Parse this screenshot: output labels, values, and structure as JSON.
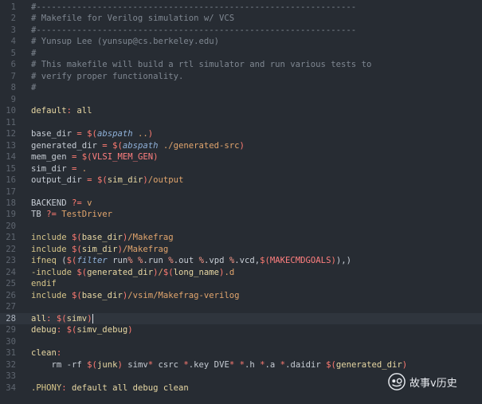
{
  "editor": {
    "language": "Makefile",
    "current_line": 28,
    "lines": [
      {
        "num": "1",
        "tokens": [
          {
            "t": "#---------------------------------------------------------------",
            "c": "comment"
          }
        ]
      },
      {
        "num": "2",
        "tokens": [
          {
            "t": "# Makefile for Verilog simulation w/ VCS",
            "c": "comment"
          }
        ]
      },
      {
        "num": "3",
        "tokens": [
          {
            "t": "#---------------------------------------------------------------",
            "c": "comment"
          }
        ]
      },
      {
        "num": "4",
        "tokens": [
          {
            "t": "# Yunsup Lee (yunsup@cs.berkeley.edu)",
            "c": "comment"
          }
        ]
      },
      {
        "num": "5",
        "tokens": [
          {
            "t": "#",
            "c": "comment"
          }
        ]
      },
      {
        "num": "6",
        "tokens": [
          {
            "t": "# This makefile will build a rtl simulator and run various tests to",
            "c": "comment"
          }
        ]
      },
      {
        "num": "7",
        "tokens": [
          {
            "t": "# verify proper functionality.",
            "c": "comment"
          }
        ]
      },
      {
        "num": "8",
        "tokens": [
          {
            "t": "#",
            "c": "comment"
          }
        ]
      },
      {
        "num": "9",
        "tokens": []
      },
      {
        "num": "10",
        "tokens": [
          {
            "t": "default",
            "c": "var"
          },
          {
            "t": ": ",
            "c": "op"
          },
          {
            "t": "all",
            "c": "var"
          }
        ]
      },
      {
        "num": "11",
        "tokens": []
      },
      {
        "num": "12",
        "tokens": [
          {
            "t": "base_dir ",
            "c": "default"
          },
          {
            "t": "= ",
            "c": "op"
          },
          {
            "t": "$(",
            "c": "op"
          },
          {
            "t": "abspath",
            "c": "func"
          },
          {
            "t": " ..",
            "c": "str"
          },
          {
            "t": ")",
            "c": "op"
          }
        ]
      },
      {
        "num": "13",
        "tokens": [
          {
            "t": "generated_dir ",
            "c": "default"
          },
          {
            "t": "= ",
            "c": "op"
          },
          {
            "t": "$(",
            "c": "op"
          },
          {
            "t": "abspath",
            "c": "func"
          },
          {
            "t": " ./generated-src",
            "c": "str"
          },
          {
            "t": ")",
            "c": "op"
          }
        ]
      },
      {
        "num": "14",
        "tokens": [
          {
            "t": "mem_gen ",
            "c": "default"
          },
          {
            "t": "= ",
            "c": "op"
          },
          {
            "t": "$(",
            "c": "op"
          },
          {
            "t": "VLSI_MEM_GEN",
            "c": "const"
          },
          {
            "t": ")",
            "c": "op"
          }
        ]
      },
      {
        "num": "15",
        "tokens": [
          {
            "t": "sim_dir ",
            "c": "default"
          },
          {
            "t": "= ",
            "c": "op"
          },
          {
            "t": ".",
            "c": "str"
          }
        ]
      },
      {
        "num": "16",
        "tokens": [
          {
            "t": "output_dir ",
            "c": "default"
          },
          {
            "t": "= ",
            "c": "op"
          },
          {
            "t": "$(",
            "c": "op"
          },
          {
            "t": "sim_dir",
            "c": "var"
          },
          {
            "t": ")",
            "c": "op"
          },
          {
            "t": "/output",
            "c": "str"
          }
        ]
      },
      {
        "num": "17",
        "tokens": []
      },
      {
        "num": "18",
        "tokens": [
          {
            "t": "BACKEND ",
            "c": "default"
          },
          {
            "t": "?= ",
            "c": "op"
          },
          {
            "t": "v",
            "c": "str"
          }
        ]
      },
      {
        "num": "19",
        "tokens": [
          {
            "t": "TB ",
            "c": "default"
          },
          {
            "t": "?= ",
            "c": "op"
          },
          {
            "t": "TestDriver",
            "c": "str"
          }
        ]
      },
      {
        "num": "20",
        "tokens": []
      },
      {
        "num": "21",
        "tokens": [
          {
            "t": "include ",
            "c": "kw"
          },
          {
            "t": "$(",
            "c": "op"
          },
          {
            "t": "base_dir",
            "c": "var"
          },
          {
            "t": ")",
            "c": "op"
          },
          {
            "t": "/Makefrag",
            "c": "str"
          }
        ]
      },
      {
        "num": "22",
        "tokens": [
          {
            "t": "include ",
            "c": "kw"
          },
          {
            "t": "$(",
            "c": "op"
          },
          {
            "t": "sim_dir",
            "c": "var"
          },
          {
            "t": ")",
            "c": "op"
          },
          {
            "t": "/Makefrag",
            "c": "str"
          }
        ]
      },
      {
        "num": "23",
        "tokens": [
          {
            "t": "ifneq ",
            "c": "kw"
          },
          {
            "t": "(",
            "c": "default"
          },
          {
            "t": "$(",
            "c": "op"
          },
          {
            "t": "filter",
            "c": "func"
          },
          {
            "t": " run",
            "c": "default"
          },
          {
            "t": "%",
            "c": "pct"
          },
          {
            "t": " ",
            "c": "default"
          },
          {
            "t": "%",
            "c": "pct"
          },
          {
            "t": ".run ",
            "c": "default"
          },
          {
            "t": "%",
            "c": "pct"
          },
          {
            "t": ".out ",
            "c": "default"
          },
          {
            "t": "%",
            "c": "pct"
          },
          {
            "t": ".vpd ",
            "c": "default"
          },
          {
            "t": "%",
            "c": "pct"
          },
          {
            "t": ".vcd,",
            "c": "default"
          },
          {
            "t": "$(",
            "c": "op"
          },
          {
            "t": "MAKECMDGOALS",
            "c": "const"
          },
          {
            "t": ")",
            "c": "op"
          },
          {
            "t": "),)",
            "c": "default"
          }
        ]
      },
      {
        "num": "24",
        "tokens": [
          {
            "t": "-include ",
            "c": "kw"
          },
          {
            "t": "$(",
            "c": "op"
          },
          {
            "t": "generated_dir",
            "c": "var"
          },
          {
            "t": ")",
            "c": "op"
          },
          {
            "t": "/",
            "c": "str"
          },
          {
            "t": "$(",
            "c": "op"
          },
          {
            "t": "long_name",
            "c": "var"
          },
          {
            "t": ")",
            "c": "op"
          },
          {
            "t": ".d",
            "c": "str"
          }
        ]
      },
      {
        "num": "25",
        "tokens": [
          {
            "t": "endif",
            "c": "kw"
          }
        ]
      },
      {
        "num": "26",
        "tokens": [
          {
            "t": "include ",
            "c": "kw"
          },
          {
            "t": "$(",
            "c": "op"
          },
          {
            "t": "base_dir",
            "c": "var"
          },
          {
            "t": ")",
            "c": "op"
          },
          {
            "t": "/vsim/Makefrag-verilog",
            "c": "str"
          }
        ]
      },
      {
        "num": "27",
        "tokens": []
      },
      {
        "num": "28",
        "tokens": [
          {
            "t": "all",
            "c": "var"
          },
          {
            "t": ": ",
            "c": "op"
          },
          {
            "t": "$(",
            "c": "op"
          },
          {
            "t": "simv",
            "c": "var"
          },
          {
            "t": ")",
            "c": "op"
          }
        ]
      },
      {
        "num": "29",
        "tokens": [
          {
            "t": "debug",
            "c": "var"
          },
          {
            "t": ": ",
            "c": "op"
          },
          {
            "t": "$(",
            "c": "op"
          },
          {
            "t": "simv_debug",
            "c": "var"
          },
          {
            "t": ")",
            "c": "op"
          }
        ]
      },
      {
        "num": "30",
        "tokens": []
      },
      {
        "num": "31",
        "tokens": [
          {
            "t": "clean",
            "c": "var"
          },
          {
            "t": ":",
            "c": "op"
          }
        ]
      },
      {
        "num": "32",
        "tokens": [
          {
            "t": "    rm -rf ",
            "c": "default"
          },
          {
            "t": "$(",
            "c": "op"
          },
          {
            "t": "junk",
            "c": "var"
          },
          {
            "t": ")",
            "c": "op"
          },
          {
            "t": " simv",
            "c": "default"
          },
          {
            "t": "*",
            "c": "op"
          },
          {
            "t": " csrc ",
            "c": "default"
          },
          {
            "t": "*",
            "c": "op"
          },
          {
            "t": ".key DVE",
            "c": "default"
          },
          {
            "t": "*",
            "c": "op"
          },
          {
            "t": " ",
            "c": "default"
          },
          {
            "t": "*",
            "c": "op"
          },
          {
            "t": ".h ",
            "c": "default"
          },
          {
            "t": "*",
            "c": "op"
          },
          {
            "t": ".a ",
            "c": "default"
          },
          {
            "t": "*",
            "c": "op"
          },
          {
            "t": ".daidir ",
            "c": "default"
          },
          {
            "t": "$(",
            "c": "op"
          },
          {
            "t": "generated_dir",
            "c": "var"
          },
          {
            "t": ")",
            "c": "op"
          }
        ]
      },
      {
        "num": "33",
        "tokens": []
      },
      {
        "num": "34",
        "tokens": [
          {
            "t": ".PHONY",
            "c": "builtin"
          },
          {
            "t": ": ",
            "c": "op"
          },
          {
            "t": "default all debug clean",
            "c": "var"
          }
        ]
      }
    ]
  },
  "watermark": {
    "text": "故事v历史",
    "icon": "wechat-channel-icon"
  },
  "colors": {
    "background": "#272c33",
    "current_line": "#2f353d",
    "line_number": "#5f6670",
    "comment": "#7f8791",
    "variable": "#e7d7a3",
    "operator": "#ff7b72",
    "function": "#8fb0d8",
    "string": "#e1a56d"
  }
}
